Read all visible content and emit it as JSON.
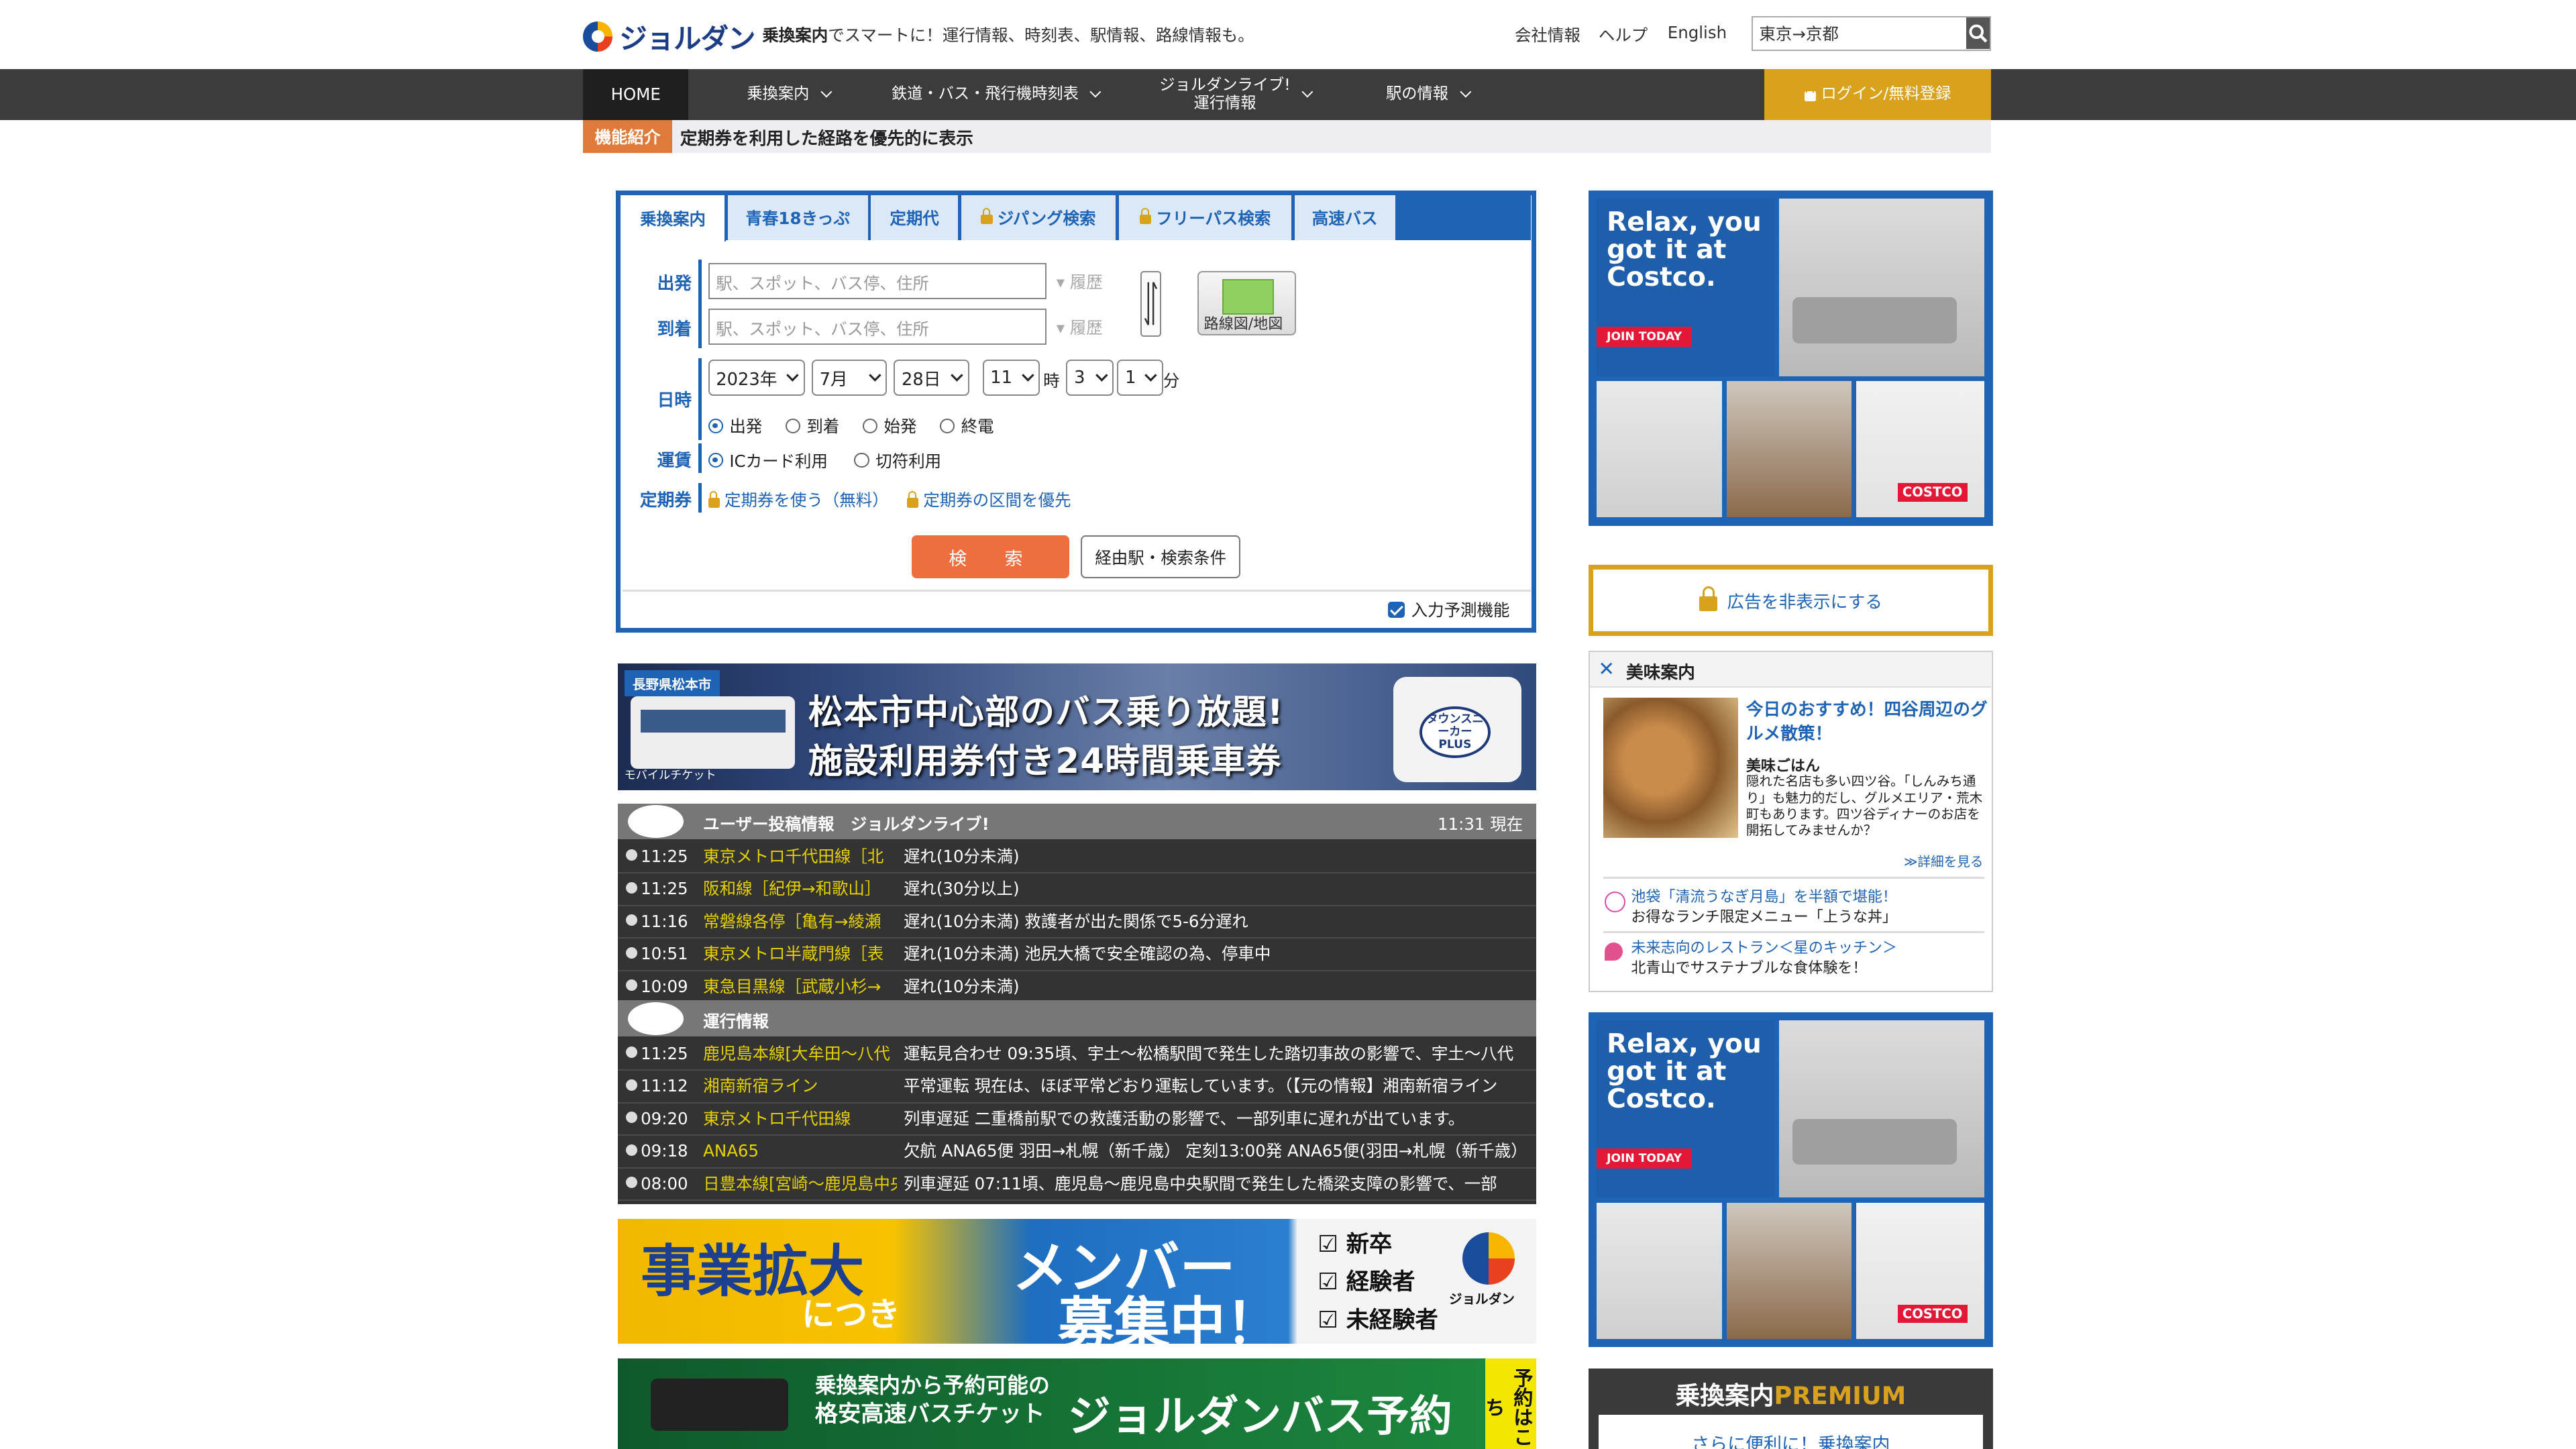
{
  "header": {
    "logo_text": "ジョルダン",
    "tagline_bold": "乗換案内",
    "tagline_rest": "でスマートに！運行情報、時刻表、駅情報、路線情報も。",
    "links": [
      "会社情報",
      "ヘルプ",
      "English"
    ],
    "search_value": "東京→京都"
  },
  "nav": {
    "home": "HOME",
    "items": [
      "乗換案内",
      "鉄道・バス・飛行機時刻表",
      "ジョルダンライブ!",
      "運行情報",
      "駅の情報"
    ],
    "login": "ログイン/無料登録"
  },
  "feature": {
    "tag": "機能紹介",
    "text": "定期券を利用した経路を優先的に表示"
  },
  "search_panel": {
    "tabs": [
      "乗換案内",
      "青春18きっぷ",
      "定期代",
      "ジパング検索",
      "フリーパス検索",
      "高速バス"
    ],
    "from_label": "出発",
    "to_label": "到着",
    "placeholder": "駅、スポット、バス停、住所",
    "history": "履歴",
    "route_map": "路線図/地図",
    "datetime_label": "日時",
    "year": "2023年",
    "month": "7月",
    "day": "28日",
    "hour": "11",
    "hour_unit": "時",
    "min_tens": "3",
    "min_ones": "1",
    "min_unit": "分",
    "time_types": [
      "出発",
      "到着",
      "始発",
      "終電"
    ],
    "fare_label": "運賃",
    "fare_types": [
      "ICカード利用",
      "切符利用"
    ],
    "pass_label": "定期券",
    "pass_use": "定期券を使う（無料）",
    "pass_priority": "定期券の区間を優先",
    "search_button": "検　索",
    "conditions_button": "経由駅・検索条件",
    "predict_label": "入力予測機能"
  },
  "bus_banner": {
    "city": "長野県松本市",
    "line1": "松本市中心部のバス乗り放題!",
    "line2": "施設利用券付き24時間乗車券",
    "mobile": "モバイルチケット",
    "plus": "タウンスニーカーPLUS"
  },
  "live": {
    "title": "ユーザー投稿情報　ジョルダンライブ!",
    "time": "11:31 現在",
    "rows": [
      {
        "time": "11:25",
        "line": "東京メトロ千代田線［北",
        "status": "遅れ(10分未満)"
      },
      {
        "time": "11:25",
        "line": "阪和線［紀伊→和歌山］",
        "status": "遅れ(30分以上)"
      },
      {
        "time": "11:16",
        "line": "常磐線各停［亀有→綾瀬",
        "status": "遅れ(10分未満)  救護者が出た関係で5-6分遅れ"
      },
      {
        "time": "10:51",
        "line": "東京メトロ半蔵門線［表",
        "status": "遅れ(10分未満)  池尻大橋で安全確認の為、停車中"
      },
      {
        "time": "10:09",
        "line": "東急目黒線［武蔵小杉→",
        "status": "遅れ(10分未満)"
      }
    ]
  },
  "operation": {
    "title": "運行情報",
    "rows": [
      {
        "time": "11:25",
        "line": "鹿児島本線[大牟田～八代",
        "status": "運転見合わせ  09:35頃、宇土～松橋駅間で発生した踏切事故の影響で、宇土～八代"
      },
      {
        "time": "11:12",
        "line": "湘南新宿ライン",
        "status": "平常運転  現在は、ほぼ平常どおり運転しています。（【元の情報】湘南新宿ライン"
      },
      {
        "time": "09:20",
        "line": "東京メトロ千代田線",
        "status": "列車遅延  二重橋前駅での救護活動の影響で、一部列車に遅れが出ています。"
      },
      {
        "time": "09:18",
        "line": "ANA65",
        "status": "欠航  ANA65便 羽田→札幌（新千歳）  定刻13:00発  ANA65便(羽田→札幌（新千歳）"
      },
      {
        "time": "08:00",
        "line": "日豊本線[宮崎～鹿児島中央]",
        "status": "列車遅延  07:11頃、鹿児島～鹿児島中央駅間で発生した橋梁支障の影響で、一部"
      }
    ]
  },
  "recruit": {
    "a": "事業拡大",
    "b": "につき",
    "c": "メンバー",
    "d": "募集中！",
    "list": [
      "新卒",
      "経験者",
      "未経験者"
    ],
    "brand": "ジョルダン"
  },
  "bus2": {
    "t1": "乗換案内から予約可能の",
    "t2": "格安高速バスチケット",
    "t3": "ジョルダンバス予約",
    "side": "予約はこち"
  },
  "ad": {
    "headline": "Relax, you got it at Costco.",
    "join": "JOIN TODAY",
    "brand": "COSTCO"
  },
  "hide_ads": "広告を非表示にする",
  "gourmet": {
    "title": "美味案内",
    "headline": "今日のおすすめ！四谷周辺のグルメ散策！",
    "sub": "美味ごはん",
    "desc": "隠れた名店も多い四ツ谷。「しんみち通り」も魅力的だし、グルメエリア・荒木町もあります。四ツ谷ディナーのお店を開拓してみませんか？",
    "more": "≫詳細を見る",
    "items": [
      {
        "a": "池袋「清流うなぎ月島」を半額で堪能！",
        "b": "お得なランチ限定メニュー「上うな丼」"
      },
      {
        "a": "未来志向のレストラン＜星のキッチン＞",
        "b": "北青山でサステナブルな食体験を！"
      }
    ]
  },
  "premium": {
    "title_a": "乗換案内",
    "title_b": "PREMIUM",
    "sub": "さらに便利に！乗換案内"
  }
}
